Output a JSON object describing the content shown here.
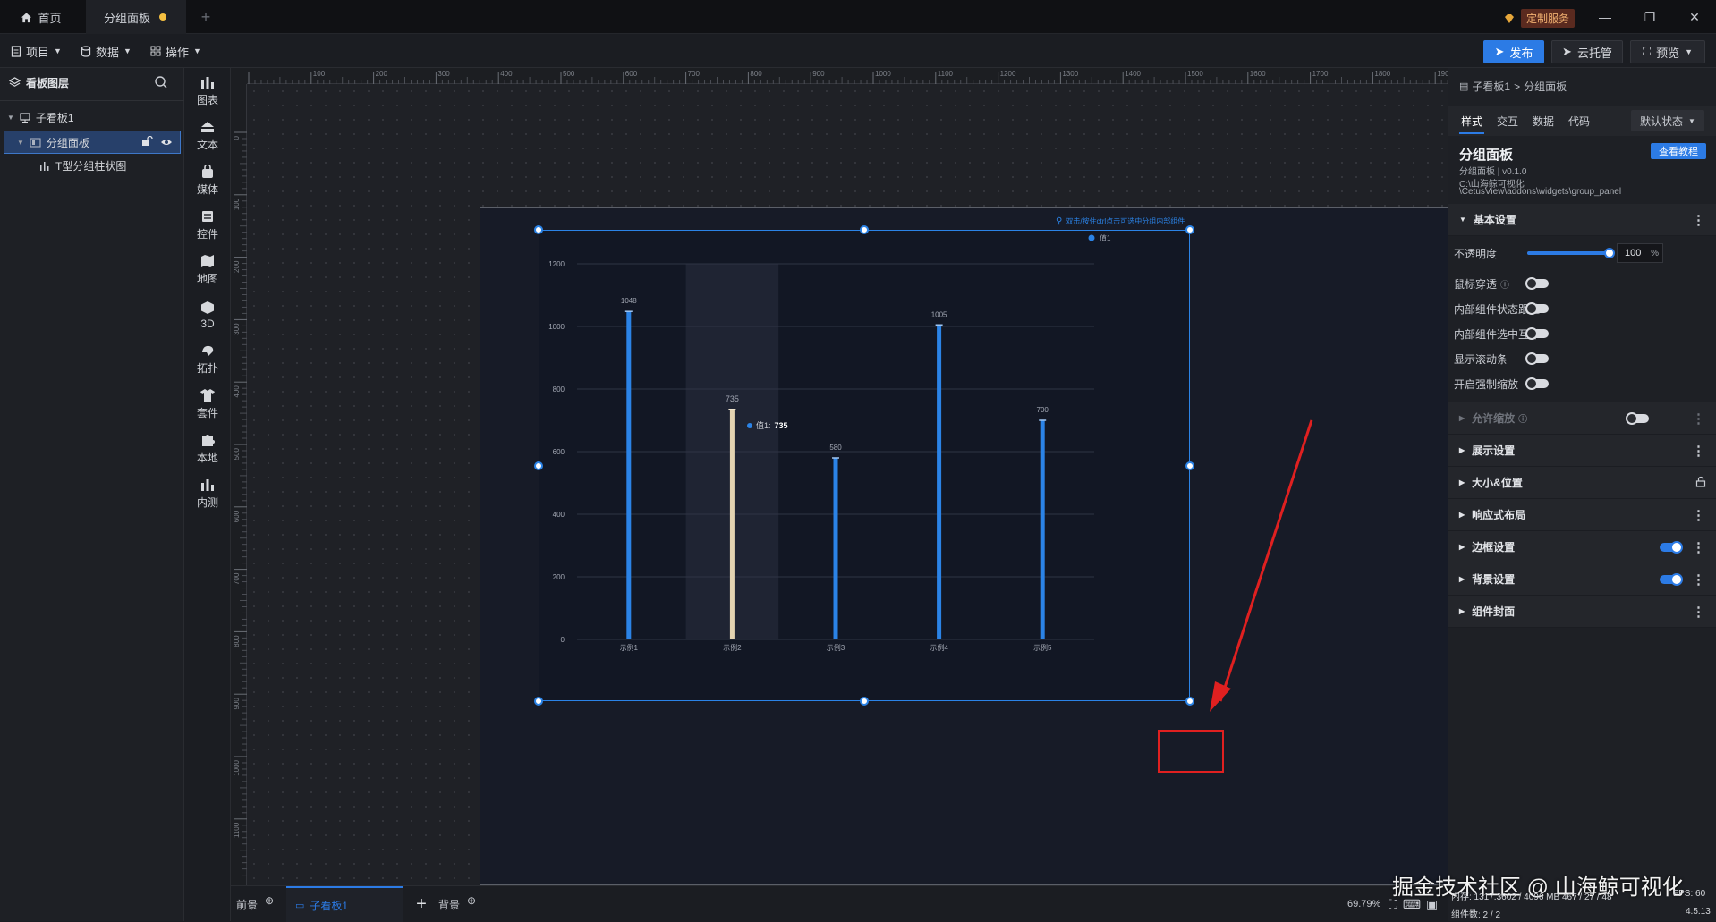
{
  "titlebar": {
    "home_tab": "首页",
    "active_tab": "分组面板",
    "new_tab": "+",
    "custom_service": "定制服务",
    "minimize": "—",
    "maximize": "❐",
    "close": "✕"
  },
  "menubar": {
    "items": [
      "项目",
      "数据",
      "操作"
    ],
    "publish": "发布",
    "cloud": "云托管",
    "preview": "预览"
  },
  "layers": {
    "title": "看板图层",
    "tree": [
      {
        "label": "子看板1"
      },
      {
        "label": "分组面板"
      },
      {
        "label": "T型分组柱状图"
      }
    ]
  },
  "rail": {
    "items": [
      "图表",
      "文本",
      "媒体",
      "控件",
      "地图",
      "3D",
      "拓扑",
      "套件",
      "本地",
      "内测"
    ]
  },
  "ruler": {
    "top_ticks": [
      "100",
      "200",
      "300",
      "400",
      "500",
      "600",
      "700",
      "800",
      "900",
      "1000",
      "1100",
      "1200",
      "1300",
      "1400",
      "1500",
      "1600",
      "1700",
      "1800",
      "1900"
    ],
    "left_ticks": [
      "0",
      "100",
      "200",
      "300",
      "400",
      "500",
      "600",
      "700",
      "800",
      "900",
      "1000",
      "1100"
    ]
  },
  "widget": {
    "hint": "双击/按住ctrl点击可选中分组内部组件",
    "legend": "值1",
    "tooltip_label": "值1:",
    "tooltip_value": "735"
  },
  "chart_data": {
    "type": "bar",
    "categories": [
      "示例1",
      "示例2",
      "示例3",
      "示例4",
      "示例5"
    ],
    "series": [
      {
        "name": "值1",
        "values": [
          1048,
          735,
          580,
          1005,
          700
        ]
      }
    ],
    "ylim": [
      0,
      1200
    ],
    "yticks": [
      "0",
      "200",
      "400",
      "600",
      "800",
      "1000",
      "1200"
    ],
    "data_labels": [
      "1048",
      "735",
      "580",
      "1005",
      "700"
    ],
    "highlighted_category": "示例2",
    "bar_color": "#2b83e6",
    "highlight_color": "#e3d3b1",
    "grid": true,
    "legend_position": "top-right"
  },
  "bottombar": {
    "front": "前景",
    "board": "子看板1",
    "add": "+",
    "back": "背景",
    "zoom": "69.79%",
    "watermark": "掘金技术社区 @ 山海鲸可视化",
    "mem": "内存: 1317.3602 / 4096 MB  467 / 27 / 48",
    "fps": "FPS: 60",
    "count": "组件数: 2 / 2",
    "version": "4.5.13"
  },
  "right": {
    "breadcrumb_parent": "子看板1",
    "breadcrumb_sep": ">",
    "breadcrumb_current": "分组面板",
    "tabs": [
      "样式",
      "交互",
      "数据",
      "代码"
    ],
    "state": "默认状态",
    "name": "分组面板",
    "tutorial": "查看教程",
    "version": "分组面板 | v0.1.0",
    "path1": "C:\\山海鲸可视化",
    "path2": "\\CetusView\\addons\\widgets\\group_panel",
    "basic": "基本设置",
    "opacity_label": "不透明度",
    "opacity_value": "100",
    "opacity_unit": "%",
    "opacity_level": 1.0,
    "props": [
      "鼠标穿透",
      "内部组件状态跟随",
      "内部组件选中互斥",
      "显示滚动条",
      "开启强制缩放"
    ],
    "zoom_section": "允许缩放",
    "sections": [
      "展示设置",
      "大小&位置",
      "响应式布局",
      "边框设置",
      "背景设置",
      "组件封面"
    ]
  }
}
